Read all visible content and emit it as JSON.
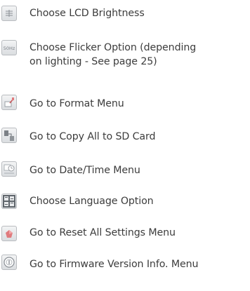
{
  "items": [
    {
      "label": "Choose LCD Brightness",
      "icon": "lcd-brightness-icon"
    },
    {
      "label": "Choose Flicker Option (depending on lighting - See page 25)",
      "icon": "flicker-50hz-icon",
      "icon_text": "50Hz"
    },
    {
      "label": "Go to Format Menu",
      "icon": "format-icon"
    },
    {
      "label": "Go to Copy All to SD Card",
      "icon": "copy-to-sd-icon"
    },
    {
      "label": "Go to Date/Time Menu",
      "icon": "date-time-icon"
    },
    {
      "label": "Choose Language Option",
      "icon": "language-icon"
    },
    {
      "label": "Go to Reset All Settings Menu",
      "icon": "reset-icon"
    },
    {
      "label": "Go to Firmware Version Info. Menu",
      "icon": "firmware-info-icon"
    }
  ]
}
